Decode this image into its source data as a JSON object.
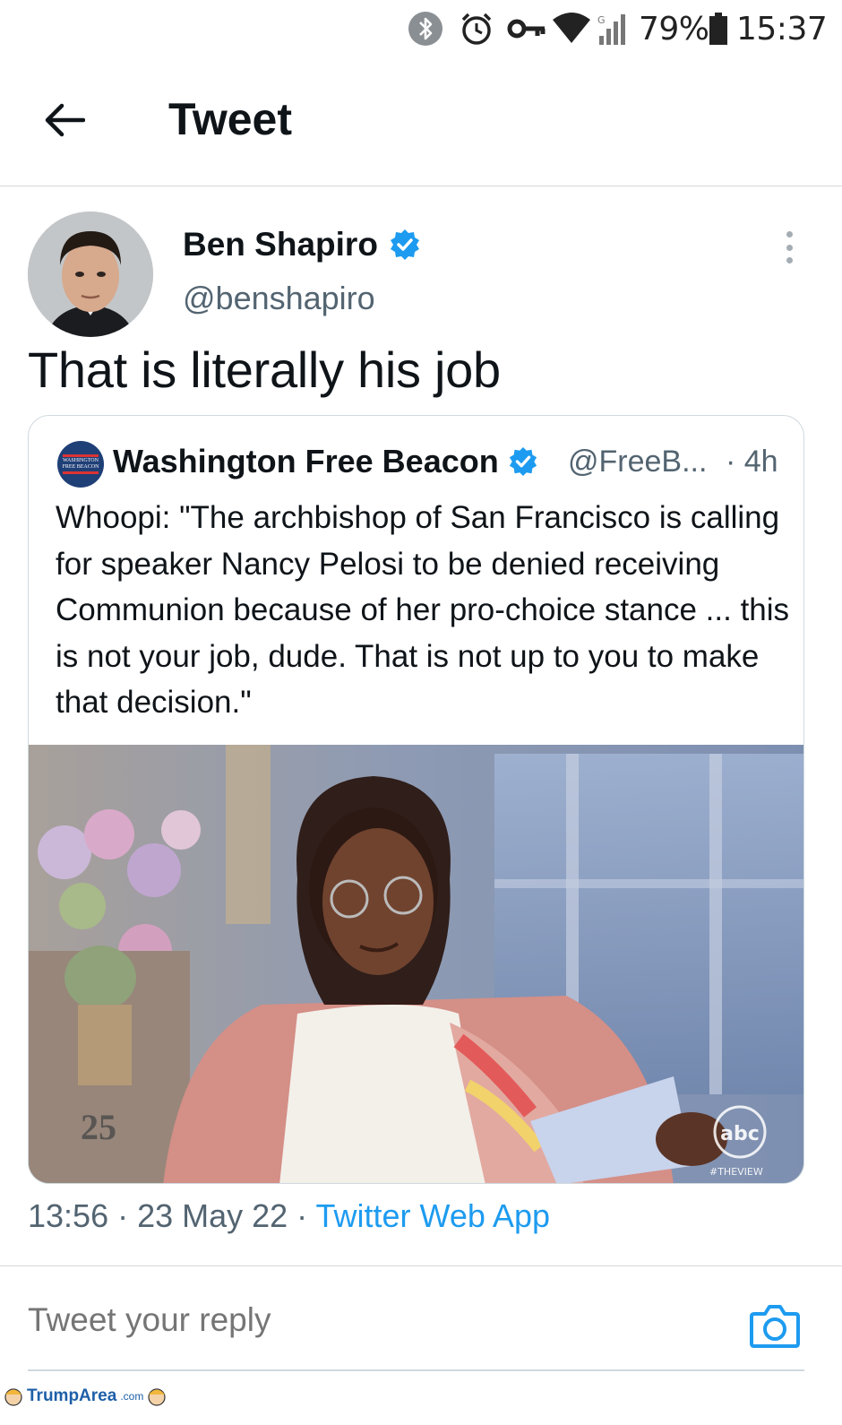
{
  "status_bar": {
    "battery_percent": "79%",
    "time": "15:37",
    "icons": [
      "bluetooth-icon",
      "alarm-icon",
      "vpn-key-icon",
      "wifi-icon",
      "signal-icon",
      "battery-icon"
    ]
  },
  "header": {
    "title": "Tweet"
  },
  "tweet": {
    "author_name": "Ben Shapiro",
    "author_handle": "@benshapiro",
    "verified": true,
    "text": "That is literally his job",
    "timestamp": "13:56 · 23 May 22 · ",
    "source": "Twitter Web App"
  },
  "quoted_tweet": {
    "author_name": "Washington Free Beacon",
    "author_handle": "@FreeB...",
    "time_ago": "· 4h",
    "verified": true,
    "avatar_text": [
      "WASHINGTON",
      "FREE BEACON"
    ],
    "text": "Whoopi: \"The archbishop of San Francisco is calling for speaker Nancy Pelosi to be denied receiving Communion because of her pro-choice stance ... this is not your job, dude. That is not up to you to make that decision.\"",
    "media": {
      "network_logo": "abc",
      "show_tag": "#THEVIEW",
      "season_badge": "25"
    }
  },
  "reply": {
    "placeholder": "Tweet your reply"
  },
  "watermark": {
    "text": "TrumpArea",
    "suffix": ".com"
  },
  "colors": {
    "accent": "#1d9bf0",
    "text_primary": "#0f1419",
    "text_secondary": "#536471",
    "border": "#cfd9de"
  }
}
